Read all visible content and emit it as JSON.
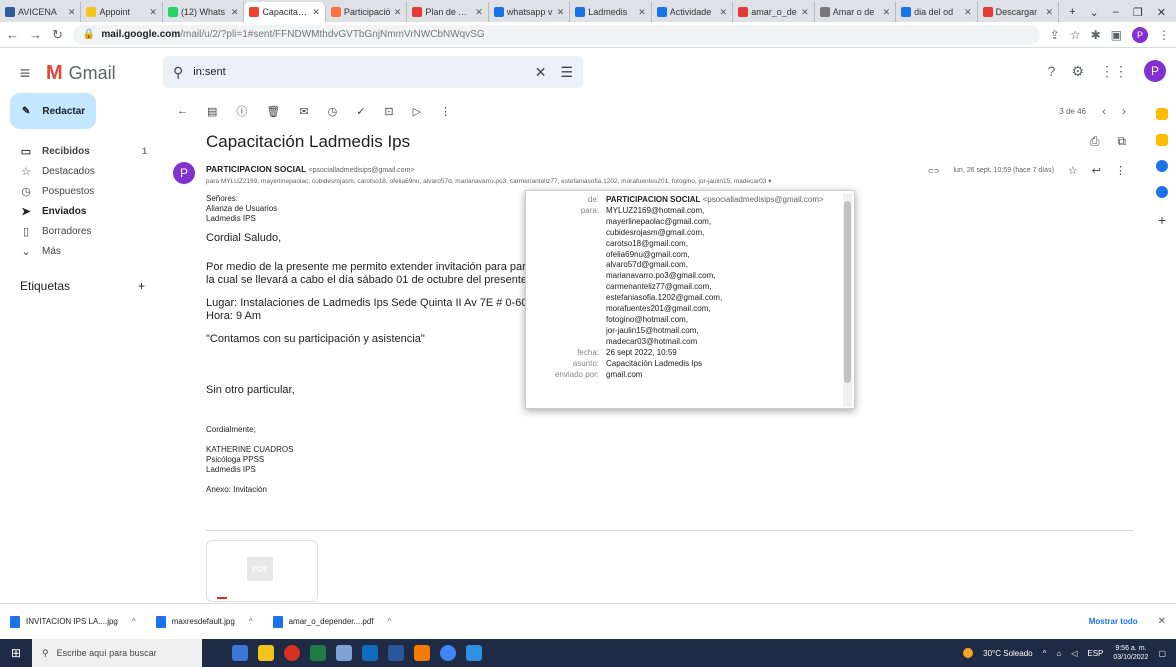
{
  "browser": {
    "tabs": [
      {
        "title": "AVICENA",
        "color": "#2e5c9a",
        "active": false
      },
      {
        "title": "Appoint",
        "color": "#f5c518",
        "active": false
      },
      {
        "title": "(12) Whats",
        "color": "#25d366",
        "active": false
      },
      {
        "title": "Capacitació",
        "color": "#ea4335",
        "active": true
      },
      {
        "title": "Participació",
        "color": "#ff7043",
        "active": false
      },
      {
        "title": "Plan de Acc",
        "color": "#e53935",
        "active": false
      },
      {
        "title": "whatsapp v",
        "color": "#1a73e8",
        "active": false
      },
      {
        "title": "Ladmedis",
        "color": "#1a73e8",
        "active": false
      },
      {
        "title": "Actividade",
        "color": "#1a73e8",
        "active": false
      },
      {
        "title": "amar_o_de",
        "color": "#e53935",
        "active": false
      },
      {
        "title": "Amar o de",
        "color": "#777777",
        "active": false
      },
      {
        "title": "dia del od",
        "color": "#1a73e8",
        "active": false
      },
      {
        "title": "Descargar",
        "color": "#e53935",
        "active": false
      }
    ],
    "new_tab": "+",
    "url_host": "mail.google.com",
    "url_path": "/mail/u/2/?pli=1#sent/FFNDWMthdvGVTbGnjNmmVrNWCbNWqvSG"
  },
  "gmail": {
    "brand": "Gmail",
    "search_value": "in:sent",
    "compose_label": "Redactar",
    "folders": [
      {
        "icon": "inbox-icon",
        "glyph": "▭",
        "label": "Recibidos",
        "count": "1",
        "active": false,
        "bold": true
      },
      {
        "icon": "star-icon",
        "glyph": "☆",
        "label": "Destacados",
        "count": "",
        "active": false
      },
      {
        "icon": "clock-icon",
        "glyph": "◷",
        "label": "Pospuestos",
        "count": "",
        "active": false
      },
      {
        "icon": "send-icon",
        "glyph": "➤",
        "label": "Enviados",
        "count": "",
        "active": true
      },
      {
        "icon": "draft-icon",
        "glyph": "▯",
        "label": "Borradores",
        "count": "",
        "active": false
      },
      {
        "icon": "chevron-down-icon",
        "glyph": "⌄",
        "label": "Más",
        "count": "",
        "active": false
      }
    ],
    "labels_heading": "Etiquetas",
    "labels_add": "+",
    "pagination": "3 de 46"
  },
  "email": {
    "subject": "Capacitación Ladmedis Ips",
    "sender_name": "PARTICIPACION SOCIAL",
    "sender_email": "<psocialladmedisips@gmail.com>",
    "to_line": "para MYLUZ2169, mayerlinepaolac, cubidesrojasm, carotso18, ofelia69nu, alvaro57d, marianavarro.po3, carmenanteliz77, estefaniasofia.1202, morafuentes201, fotogino, jor-jaulin15, madecar03",
    "date": "lun, 26 sept, 10:59 (hace 7 días)",
    "body": {
      "greeting_lines": [
        "Señores:",
        "Alianza de Usuarios",
        "Ladmedis IPS"
      ],
      "salutation": "Cordial Saludo,",
      "para1_a": "Por medio de la presente me permito extender invitación para participar c",
      "para1_b": "la cual se llevará a cabo el día sábado 01 de octubre del presente año.",
      "place": "Lugar: Instalaciones de Ladmedis Ips Sede Quinta II Av 7E # 0-60 Barrio",
      "time": "Hora: 9 Am",
      "quote": "\"Contamos con su participación y asistencia\"",
      "closing": "Sin otro particular,",
      "sign_a": "Cordialmente;",
      "sign_name": "KATHERINE CUADROS",
      "sign_role": "Psicóloga PPSS",
      "sign_org": "Ladmedis IPS",
      "annex": "Anexo: Invitación"
    },
    "attachment_badge": "PDF"
  },
  "details_popup": {
    "from_label": "de:",
    "from_name": "PARTICIPACION SOCIAL",
    "from_email": "<psocialladmedisips@gmail.com>",
    "to_label": "para:",
    "to": [
      "MYLUZ2169@hotmail.com,",
      "mayerlinepaolac@gmail.com,",
      "cubidesrojasm@gmail.com,",
      "carotso18@gmail.com,",
      "ofelia69nu@gmail.com,",
      "alvaro57d@gmail.com,",
      "marianavarro.po3@gmail.com,",
      "carmenanteliz77@gmail.com,",
      "estefaniasofia.1202@gmail.com,",
      "morafuentes201@gmail.com,",
      "fotogino@hotmail.com,",
      "jor-jaulin15@hotmail.com,",
      "madecar03@hotmail.com"
    ],
    "date_label": "fecha:",
    "date_value": "26 sept 2022, 10:59",
    "subject_label": "asunto:",
    "subject_value": "Capacitación Ladmedis Ips",
    "via_label": "enviado por:",
    "via_value": "gmail.com"
  },
  "downloads": {
    "items": [
      "INVITACION IPS LA....jpg",
      "maxresdefault.jpg",
      "amar_o_depender....pdf"
    ],
    "show_all": "Mostrar todo"
  },
  "taskbar": {
    "search_placeholder": "Escribe aquí para buscar",
    "weather": "30°C Soleado",
    "lang": "ESP",
    "time": "9:56 a. m.",
    "date": "03/10/2022"
  }
}
